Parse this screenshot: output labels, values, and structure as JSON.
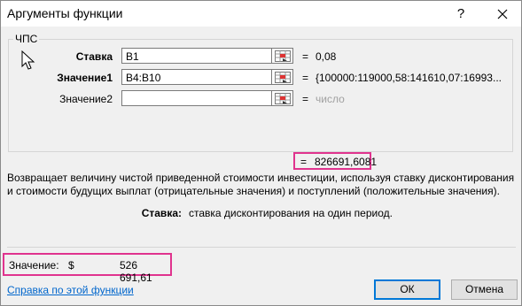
{
  "window": {
    "title": "Аргументы функции",
    "help_glyph": "?"
  },
  "group": {
    "function_name": "ЧПС"
  },
  "args": [
    {
      "label": "Ставка",
      "value": "B1",
      "result": "0,08"
    },
    {
      "label": "Значение1",
      "value": "B4:B10",
      "result": "{100000:119000,58:141610,07:16993..."
    },
    {
      "label": "Значение2",
      "value": "",
      "result": "число"
    }
  ],
  "formula_result": {
    "eq": "=",
    "value": "826691,6081"
  },
  "description": "Возвращает величину чистой приведенной стоимости инвестиции, используя ставку дисконтирования и стоимости будущих выплат (отрицательные значения) и поступлений (положительные значения).",
  "current_param": {
    "name": "Ставка:",
    "description": "ставка дисконтирования на один период."
  },
  "result": {
    "label": "Значение:",
    "currency": "$",
    "amount": "526 691,61"
  },
  "help_link": "Справка по этой функции",
  "buttons": {
    "ok": "ОК",
    "cancel": "Отмена"
  },
  "colors": {
    "highlight": "#e0338e",
    "link": "#0066cc",
    "primary_border": "#0078d7"
  }
}
